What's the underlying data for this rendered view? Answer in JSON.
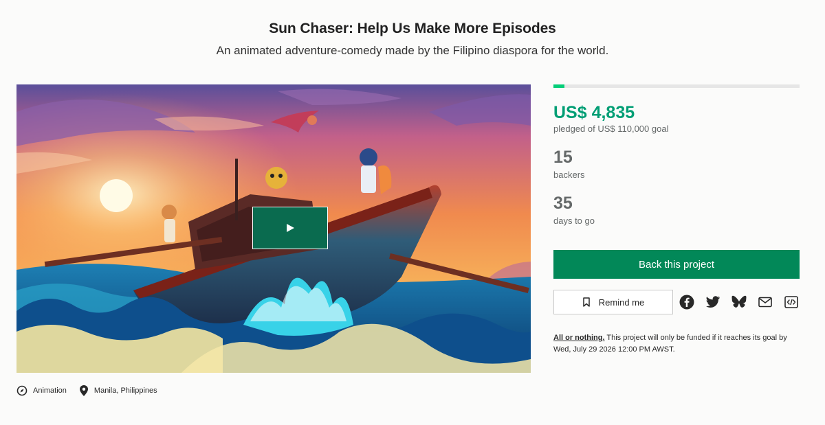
{
  "project": {
    "title": "Sun Chaser: Help Us Make More Episodes",
    "subtitle": "An animated adventure-comedy made by the Filipino diaspora for the world."
  },
  "media": {
    "play_icon": "play-icon"
  },
  "meta": {
    "category": "Animation",
    "category_icon": "compass-icon",
    "location": "Manila, Philippines",
    "location_icon": "map-pin-icon"
  },
  "funding": {
    "progress_fraction": 0.044,
    "progress_color": "#05ce78",
    "pledged": "US$ 4,835",
    "pledged_caption": "pledged of US$ 110,000 goal",
    "backers": "15",
    "backers_caption": "backers",
    "days": "35",
    "days_caption": "days to go"
  },
  "actions": {
    "back_label": "Back this project",
    "back_color": "#028858",
    "remind_label": "Remind me",
    "remind_icon": "bookmark-icon",
    "share_icons": [
      "facebook-icon",
      "twitter-icon",
      "bluesky-icon",
      "email-icon",
      "embed-icon"
    ]
  },
  "terms": {
    "link": "All or nothing.",
    "text": " This project will only be funded if it reaches its goal by Wed, July 29 2026 12:00 PM AWST."
  }
}
